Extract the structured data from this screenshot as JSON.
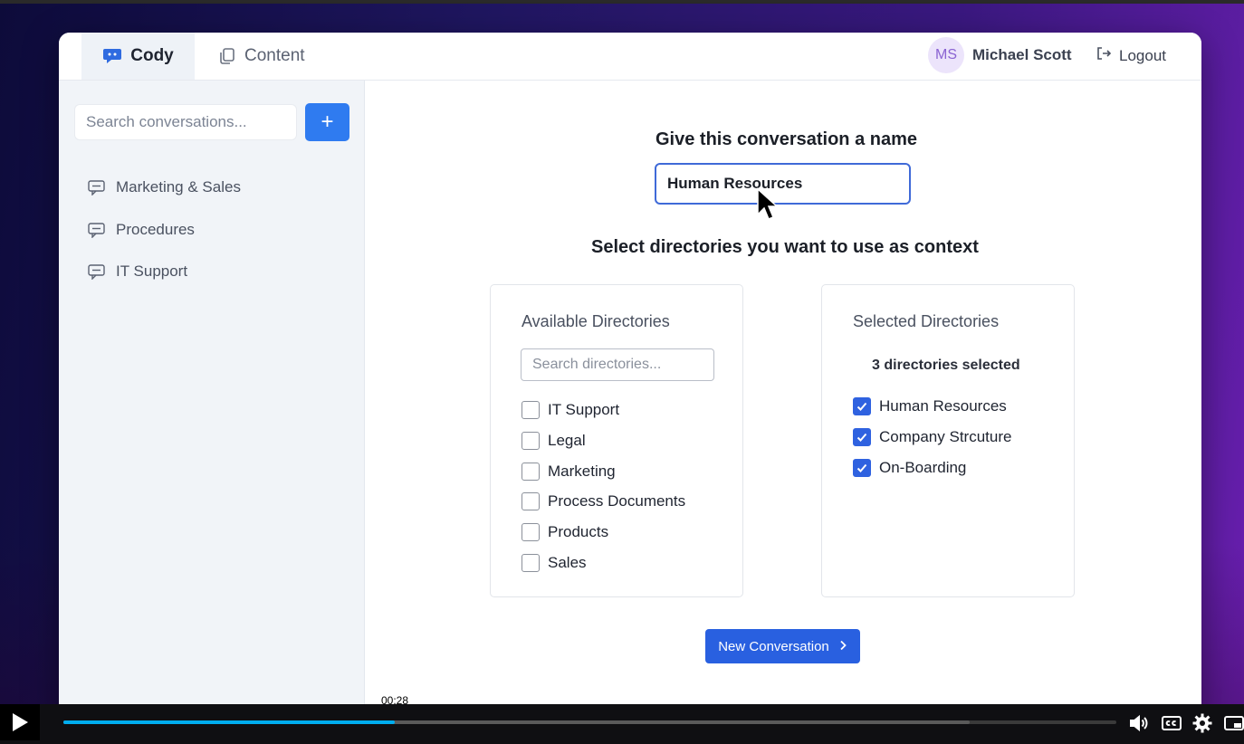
{
  "header": {
    "tabs": [
      {
        "label": "Cody",
        "active": true,
        "icon": "chat-bubble-icon"
      },
      {
        "label": "Content",
        "active": false,
        "icon": "copy-icon"
      }
    ],
    "user": {
      "initials": "MS",
      "name": "Michael Scott"
    },
    "logout_label": "Logout"
  },
  "sidebar": {
    "search_placeholder": "Search conversations...",
    "add_button": "+",
    "conversations": [
      {
        "label": "Marketing & Sales"
      },
      {
        "label": "Procedures"
      },
      {
        "label": "IT Support"
      }
    ]
  },
  "main": {
    "name_heading": "Give this conversation a name",
    "name_value": "Human Resources",
    "context_heading": "Select directories you want to use as context",
    "available": {
      "title": "Available Directories",
      "search_placeholder": "Search directories...",
      "items": [
        {
          "label": "IT Support",
          "checked": false
        },
        {
          "label": "Legal",
          "checked": false
        },
        {
          "label": "Marketing",
          "checked": false
        },
        {
          "label": "Process Documents",
          "checked": false
        },
        {
          "label": "Products",
          "checked": false
        },
        {
          "label": "Sales",
          "checked": false
        }
      ]
    },
    "selected": {
      "title": "Selected Directories",
      "count_text": "3 directories selected",
      "items": [
        {
          "label": "Human Resources",
          "checked": true
        },
        {
          "label": "Company Strcuture",
          "checked": true
        },
        {
          "label": "On-Boarding",
          "checked": true
        }
      ]
    },
    "new_conversation_label": "New Conversation"
  },
  "player": {
    "timecode": "00:28",
    "played_fraction": 0.315,
    "buffered_fraction": 0.861
  },
  "colors": {
    "accent": "#2f7bf0",
    "checkbox": "#2f62e0",
    "progress": "#00adef"
  }
}
